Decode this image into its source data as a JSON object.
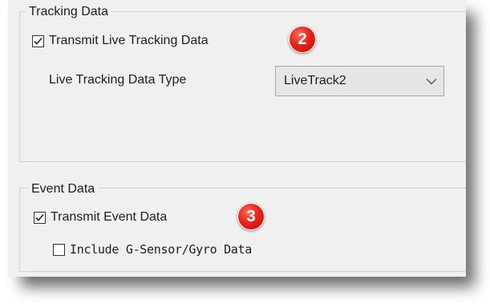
{
  "tracking": {
    "title": "Tracking Data",
    "transmit_label": "Transmit Live Tracking Data",
    "transmit_checked": true,
    "type_label": "Live Tracking Data Type",
    "type_value": "LiveTrack2",
    "badge": "2"
  },
  "event": {
    "title": "Event Data",
    "transmit_label": "Transmit Event Data",
    "transmit_checked": true,
    "gsensor_label": "Include G-Sensor/Gyro Data",
    "gsensor_checked": false,
    "badge": "3"
  },
  "colors": {
    "badge": "#e8231a",
    "panel": "#f0f0f0"
  },
  "icons": [
    "checkmark-icon",
    "chevron-down-icon"
  ]
}
